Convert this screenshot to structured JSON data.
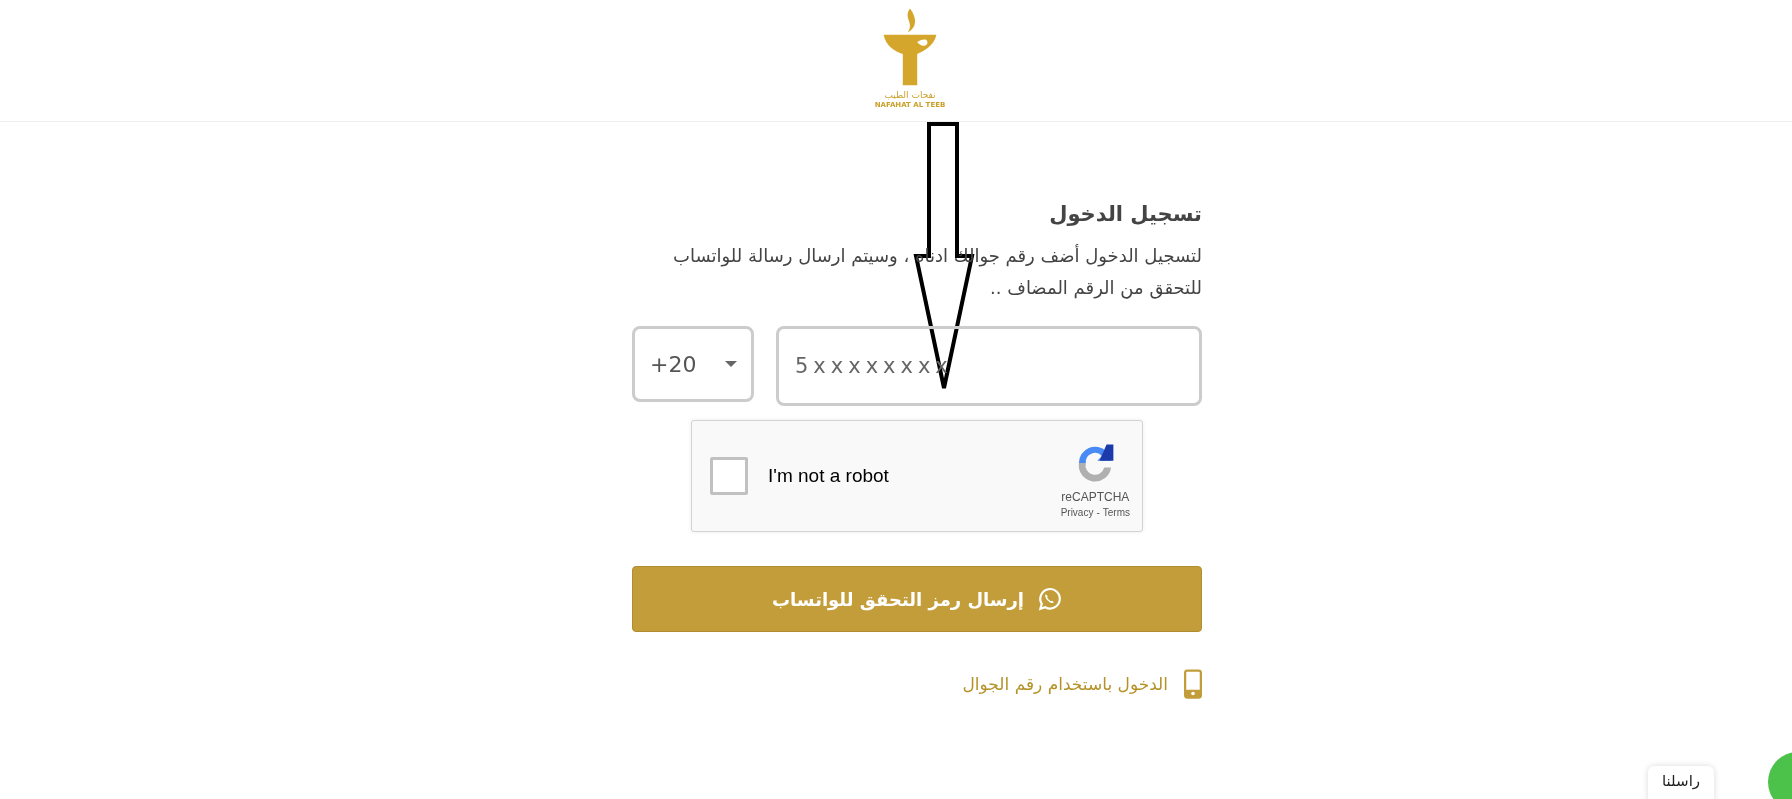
{
  "header": {
    "logo": {
      "arabic": "نفحات الطيب",
      "latin": "NAFAHAT AL TEEB"
    }
  },
  "login": {
    "title": "تسجيل الدخول",
    "description": "لتسجيل الدخول أضف رقم جوالك ادناه ، وسيتم ارسال رسالة للواتساب للتحقق من الرقم المضاف ..",
    "country_code": "+20",
    "phone": {
      "placeholder": "5xxxxxxxx"
    },
    "captcha": {
      "label": "I'm not a robot",
      "checked": false,
      "brand": "reCAPTCHA",
      "privacy": "Privacy",
      "separator": "-",
      "terms": "Terms"
    },
    "submit_button": "إرسال رمز التحقق للواتساب",
    "alt_login_link": "الدخول باستخدام رقم الجوال"
  },
  "chat_widget": {
    "label": "راسلنا"
  }
}
